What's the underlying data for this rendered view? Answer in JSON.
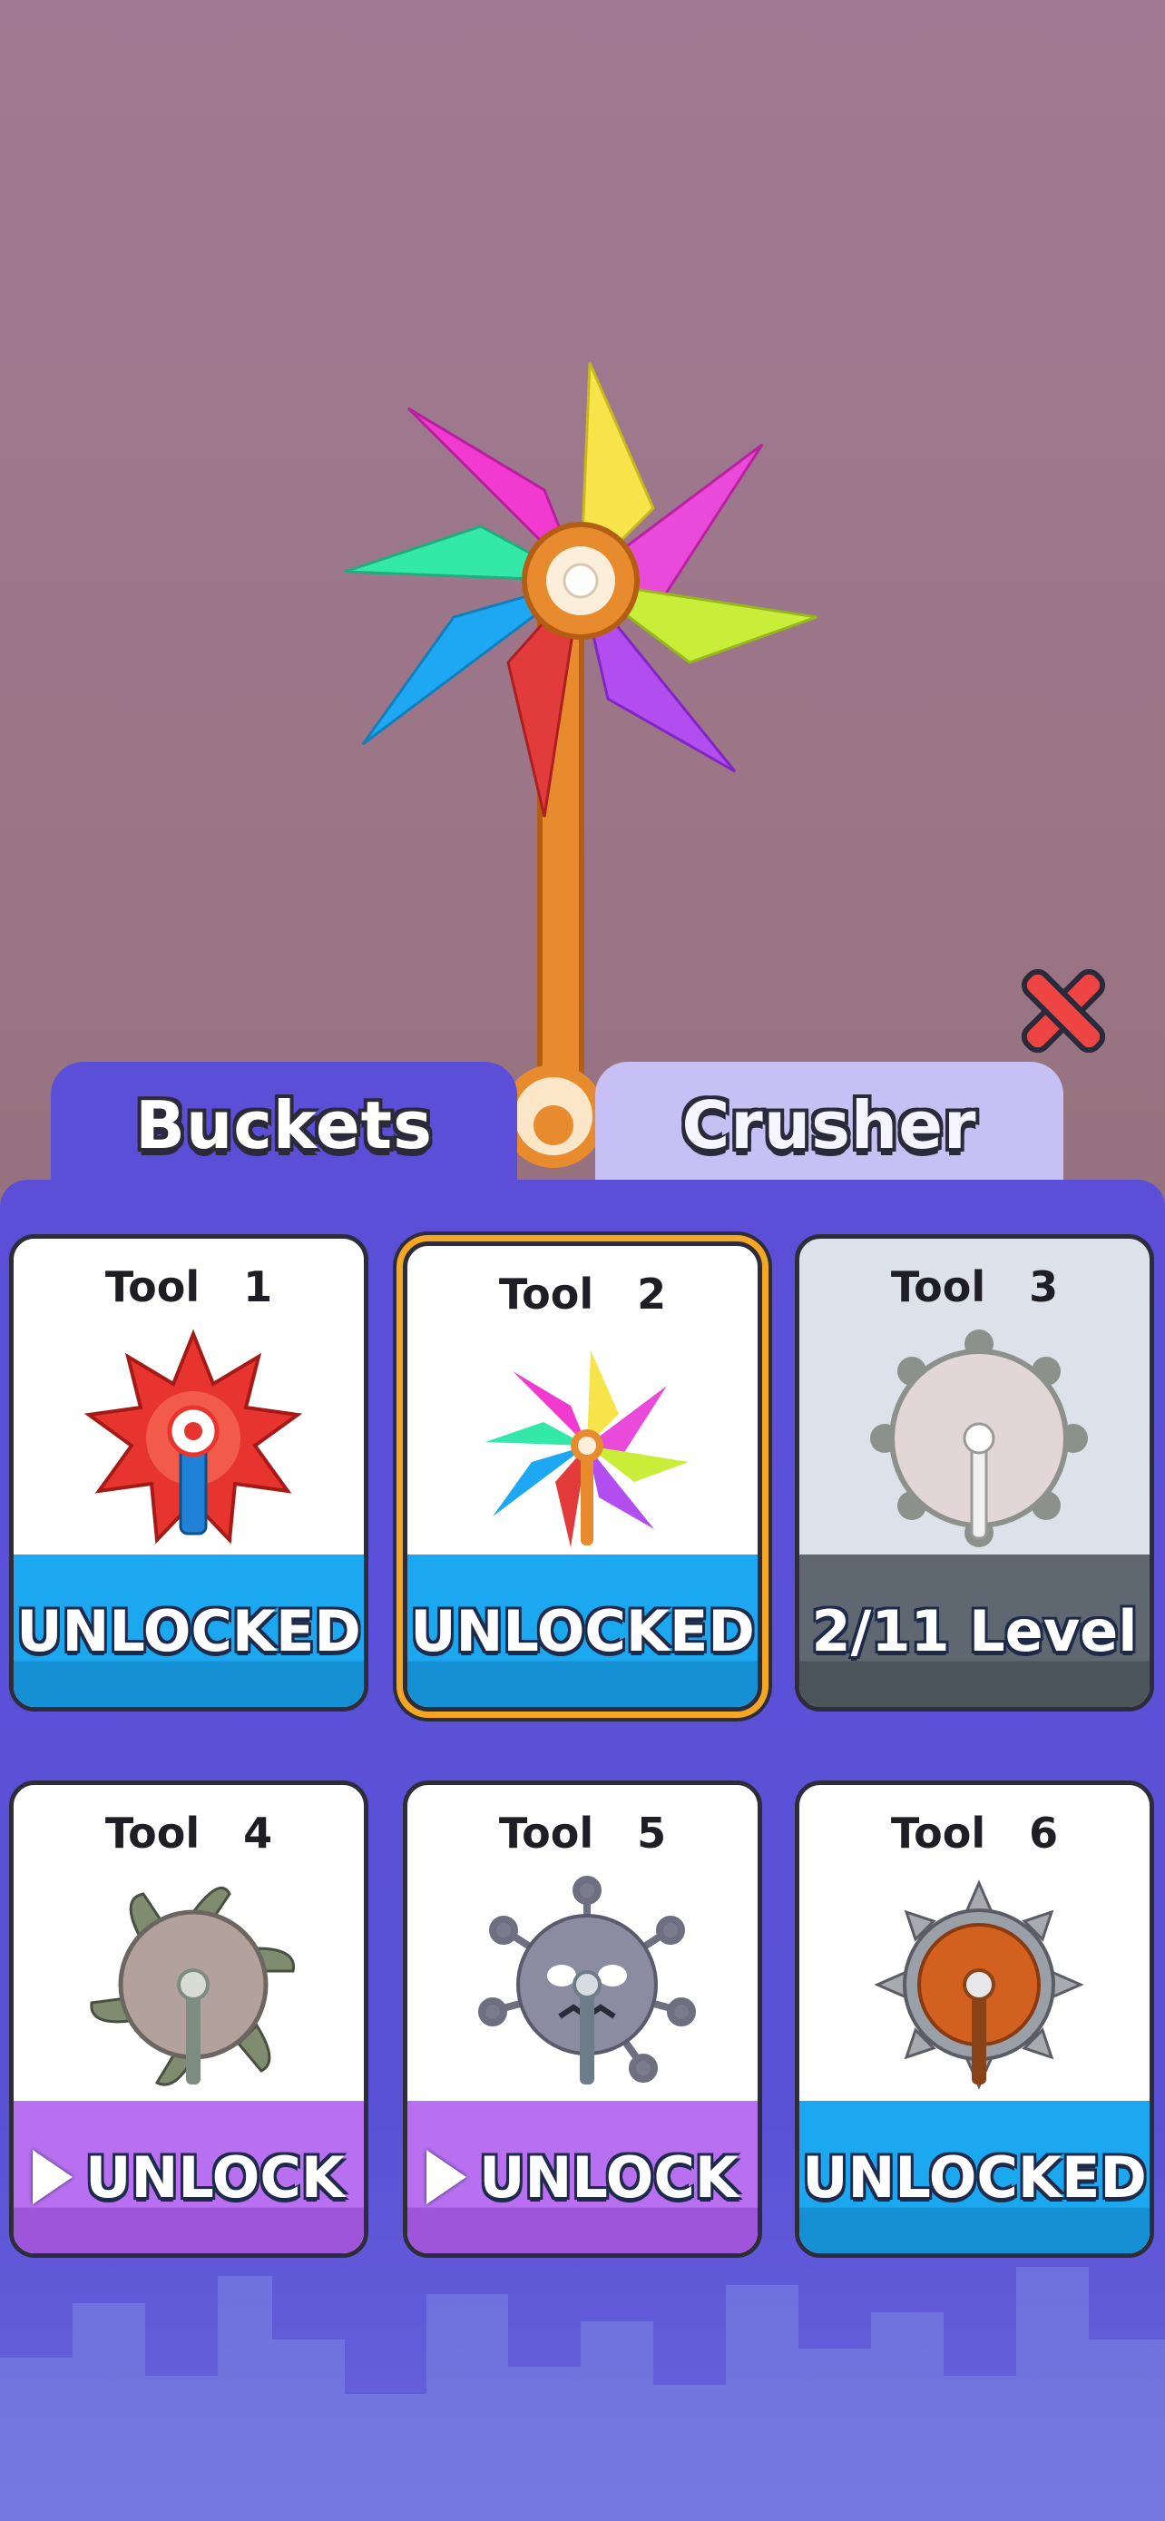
{
  "tabs": {
    "buckets_label": "Buckets",
    "crusher_label": "Crusher",
    "active": "Buckets"
  },
  "close_button_icon": "close-x-icon",
  "tools": [
    {
      "title": "Tool   1",
      "status": "UNLOCKED",
      "status_style": "blue",
      "icon": "red-star-saw-icon"
    },
    {
      "title": "Tool   2",
      "status": "UNLOCKED",
      "status_style": "blue",
      "icon": "pinwheel-icon",
      "selected": true
    },
    {
      "title": "Tool   3",
      "status": "2/11 Level",
      "status_style": "gray",
      "icon": "gear-disc-icon"
    },
    {
      "title": "Tool   4",
      "status": "UNLOCK",
      "status_style": "purple",
      "icon": "spiked-saw-icon",
      "play_icon": true
    },
    {
      "title": "Tool   5",
      "status": "UNLOCK",
      "status_style": "purple",
      "icon": "virus-face-icon",
      "play_icon": true
    },
    {
      "title": "Tool   6",
      "status": "UNLOCKED",
      "status_style": "blue",
      "icon": "spiked-wooden-wheel-icon"
    }
  ],
  "colors": {
    "panel": "#5b4fd8",
    "unlocked_blue": "#1ca8f0",
    "locked_gray": "#5f6770",
    "unlock_purple": "#b86ff0",
    "selected_border": "#f5a623",
    "close_red": "#ee4444"
  }
}
